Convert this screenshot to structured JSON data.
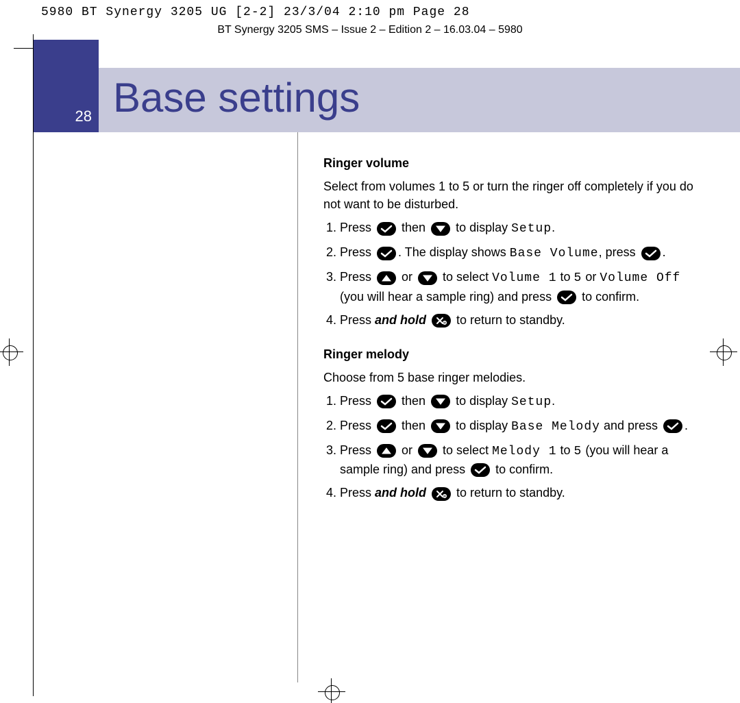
{
  "slug": "5980 BT Synergy 3205 UG [2-2]  23/3/04  2:10 pm  Page 28",
  "running_head": "BT Synergy 3205 SMS – Issue 2 – Edition 2 – 16.03.04 – 5980",
  "page_number": "28",
  "title": "Base settings",
  "sections": [
    {
      "heading": "Ringer volume",
      "intro": "Select from volumes 1 to 5 or turn the ringer off completely if you do not want to be disturbed.",
      "steps": [
        {
          "parts": [
            "Press ",
            {
              "icon": "ok"
            },
            " then ",
            {
              "icon": "down"
            },
            " to display ",
            {
              "lcd": "Setup"
            },
            "."
          ]
        },
        {
          "parts": [
            "Press ",
            {
              "icon": "ok"
            },
            ". The display shows ",
            {
              "lcd": "Base Volume"
            },
            ", press ",
            {
              "icon": "ok"
            },
            "."
          ]
        },
        {
          "parts": [
            "Press ",
            {
              "icon": "up"
            },
            " or ",
            {
              "icon": "down"
            },
            " to select ",
            {
              "lcd": "Volume 1"
            },
            " to ",
            {
              "lcd": "5"
            },
            " or ",
            {
              "lcd": "Volume Off"
            },
            " (you will hear a sample ring) and press ",
            {
              "icon": "ok"
            },
            " to confirm."
          ]
        },
        {
          "parts": [
            "Press ",
            {
              "bi": "and hold"
            },
            " ",
            {
              "icon": "cancel"
            },
            " to return to standby."
          ]
        }
      ]
    },
    {
      "heading": "Ringer melody",
      "intro": "Choose from 5 base ringer melodies.",
      "steps": [
        {
          "parts": [
            "Press ",
            {
              "icon": "ok"
            },
            " then ",
            {
              "icon": "down"
            },
            " to display ",
            {
              "lcd": "Setup"
            },
            "."
          ]
        },
        {
          "parts": [
            "Press ",
            {
              "icon": "ok"
            },
            " then ",
            {
              "icon": "down"
            },
            " to display ",
            {
              "lcd": "Base Melody"
            },
            " and press ",
            {
              "icon": "ok"
            },
            "."
          ]
        },
        {
          "parts": [
            "Press ",
            {
              "icon": "up"
            },
            " or ",
            {
              "icon": "down"
            },
            " to select ",
            {
              "lcd": "Melody 1"
            },
            " to ",
            {
              "lcd": "5"
            },
            " (you will hear a sample ring) and press ",
            {
              "icon": "ok"
            },
            " to confirm."
          ]
        },
        {
          "parts": [
            "Press ",
            {
              "bi": "and hold"
            },
            " ",
            {
              "icon": "cancel"
            },
            " to return to standby."
          ]
        }
      ]
    }
  ]
}
